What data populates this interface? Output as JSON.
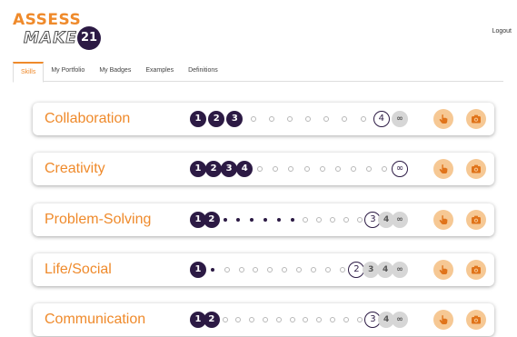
{
  "logo": {
    "line1": "ASSESS",
    "line2": "MAKE",
    "badge": "21"
  },
  "header": {
    "logout_label": "Logout"
  },
  "tabs": [
    {
      "label": "Skills",
      "active": true
    },
    {
      "label": "My Portfolio",
      "active": false
    },
    {
      "label": "My Badges",
      "active": false
    },
    {
      "label": "Examples",
      "active": false
    },
    {
      "label": "Definitions",
      "active": false
    }
  ],
  "colors": {
    "accent": "#ef8a2b",
    "dark": "#2c1a44",
    "future": "#d6d6d6",
    "action_bg": "#f6c894"
  },
  "action_icons": [
    "hand-pointer-icon",
    "camera-icon"
  ],
  "skills": [
    {
      "name": "Collaboration",
      "track": [
        {
          "k": "done",
          "v": "1"
        },
        {
          "k": "done",
          "v": "2"
        },
        {
          "k": "done",
          "v": "3"
        },
        {
          "k": "o"
        },
        {
          "k": "o"
        },
        {
          "k": "o"
        },
        {
          "k": "o"
        },
        {
          "k": "o"
        },
        {
          "k": "o"
        },
        {
          "k": "o"
        },
        {
          "k": "goal",
          "v": "4"
        },
        {
          "k": "future",
          "v": "∞"
        }
      ]
    },
    {
      "name": "Creativity",
      "track": [
        {
          "k": "done",
          "v": "1"
        },
        {
          "k": "done",
          "v": "2"
        },
        {
          "k": "done",
          "v": "3"
        },
        {
          "k": "done",
          "v": "4"
        },
        {
          "k": "o"
        },
        {
          "k": "o"
        },
        {
          "k": "o"
        },
        {
          "k": "o"
        },
        {
          "k": "o"
        },
        {
          "k": "o"
        },
        {
          "k": "o"
        },
        {
          "k": "o"
        },
        {
          "k": "o"
        },
        {
          "k": "goal",
          "v": "∞"
        }
      ]
    },
    {
      "name": "Problem-Solving",
      "track": [
        {
          "k": "done",
          "v": "1"
        },
        {
          "k": "done",
          "v": "2"
        },
        {
          "k": "f"
        },
        {
          "k": "f"
        },
        {
          "k": "f"
        },
        {
          "k": "f"
        },
        {
          "k": "f"
        },
        {
          "k": "f"
        },
        {
          "k": "o"
        },
        {
          "k": "o"
        },
        {
          "k": "o"
        },
        {
          "k": "o"
        },
        {
          "k": "o"
        },
        {
          "k": "goal",
          "v": "3"
        },
        {
          "k": "future",
          "v": "4"
        },
        {
          "k": "future",
          "v": "∞"
        }
      ]
    },
    {
      "name": "Life/Social",
      "track": [
        {
          "k": "done",
          "v": "1"
        },
        {
          "k": "f"
        },
        {
          "k": "o"
        },
        {
          "k": "o"
        },
        {
          "k": "o"
        },
        {
          "k": "o"
        },
        {
          "k": "o"
        },
        {
          "k": "o"
        },
        {
          "k": "o"
        },
        {
          "k": "o"
        },
        {
          "k": "o"
        },
        {
          "k": "goal",
          "v": "2"
        },
        {
          "k": "future",
          "v": "3"
        },
        {
          "k": "future",
          "v": "4"
        },
        {
          "k": "future",
          "v": "∞"
        }
      ]
    },
    {
      "name": "Communication",
      "track": [
        {
          "k": "done",
          "v": "1"
        },
        {
          "k": "done",
          "v": "2"
        },
        {
          "k": "o"
        },
        {
          "k": "o"
        },
        {
          "k": "o"
        },
        {
          "k": "o"
        },
        {
          "k": "o"
        },
        {
          "k": "o"
        },
        {
          "k": "o"
        },
        {
          "k": "o"
        },
        {
          "k": "o"
        },
        {
          "k": "o"
        },
        {
          "k": "o"
        },
        {
          "k": "goal",
          "v": "3"
        },
        {
          "k": "future",
          "v": "4"
        },
        {
          "k": "future",
          "v": "∞"
        }
      ]
    }
  ]
}
